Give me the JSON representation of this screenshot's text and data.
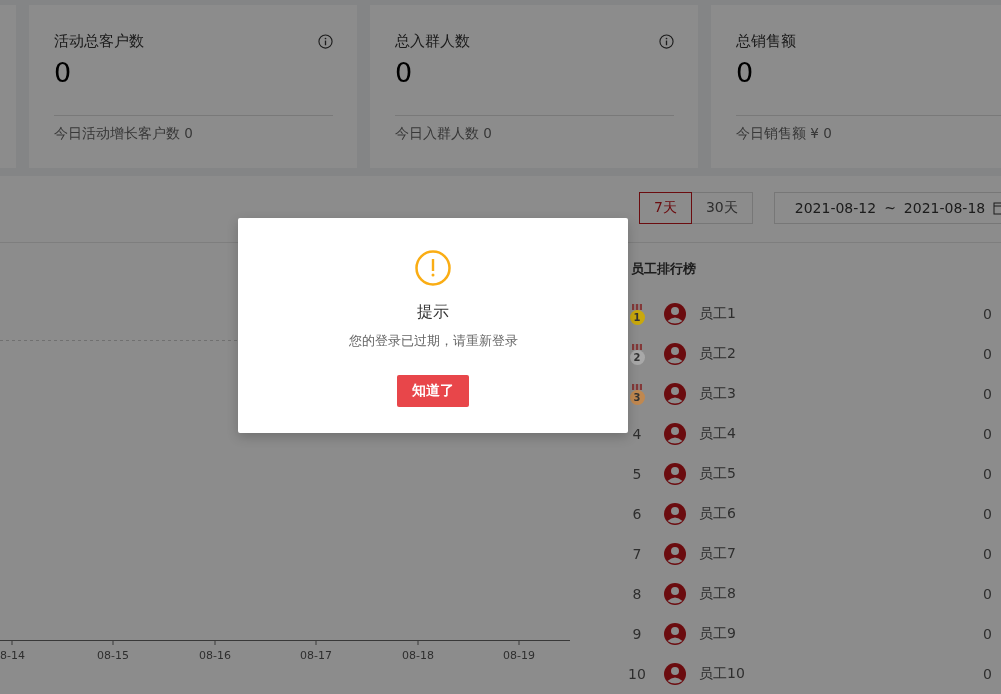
{
  "stat_cards": [
    {
      "title": "活动总客户数",
      "value": "0",
      "footer": "今日活动增长客户数 0",
      "info": true
    },
    {
      "title": "总入群人数",
      "value": "0",
      "footer": "今日入群人数 0",
      "info": true
    },
    {
      "title": "总销售额",
      "value": "0",
      "footer": "今日销售额 ¥ 0",
      "info": false
    }
  ],
  "range_tabs": [
    {
      "label": "7天",
      "selected": true
    },
    {
      "label": "30天",
      "selected": false
    }
  ],
  "date_range": {
    "start": "2021-08-12",
    "separator": "~",
    "end": "2021-08-18"
  },
  "chart": {
    "x_labels": [
      "8-14",
      "08-15",
      "08-16",
      "08-17",
      "08-18",
      "08-19"
    ]
  },
  "ranking": {
    "title": "员工排行榜",
    "rows": [
      {
        "kind": "medal",
        "rank": "1",
        "color": "#c9a80c",
        "name": "员工1",
        "value": "0"
      },
      {
        "kind": "medal",
        "rank": "2",
        "color": "#a8a8a8",
        "name": "员工2",
        "value": "0"
      },
      {
        "kind": "medal",
        "rank": "3",
        "color": "#c08850",
        "name": "员工3",
        "value": "0"
      },
      {
        "kind": "number",
        "rank": "4",
        "name": "员工4",
        "value": "0"
      },
      {
        "kind": "number",
        "rank": "5",
        "name": "员工5",
        "value": "0"
      },
      {
        "kind": "number",
        "rank": "6",
        "name": "员工6",
        "value": "0"
      },
      {
        "kind": "number",
        "rank": "7",
        "name": "员工7",
        "value": "0"
      },
      {
        "kind": "number",
        "rank": "8",
        "name": "员工8",
        "value": "0"
      },
      {
        "kind": "number",
        "rank": "9",
        "name": "员工9",
        "value": "0"
      },
      {
        "kind": "number",
        "rank": "10",
        "name": "员工10",
        "value": "0"
      }
    ]
  },
  "dialog": {
    "title": "提示",
    "message": "您的登录已过期，请重新登录",
    "button": "知道了"
  }
}
